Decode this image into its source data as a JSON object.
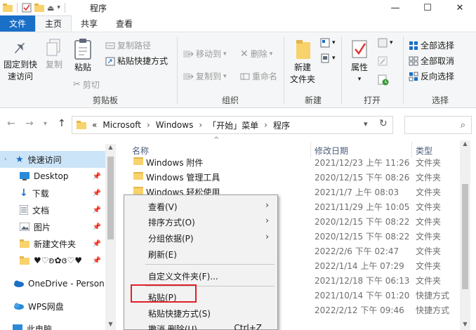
{
  "window": {
    "title": "程序"
  },
  "tabs": [
    "文件",
    "主页",
    "共享",
    "查看"
  ],
  "ribbon": {
    "pin_quick_access": [
      "固定到快",
      "速访问"
    ],
    "copy": "复制",
    "paste": "粘贴",
    "copy_path": "复制路径",
    "paste_shortcut": "粘贴快捷方式",
    "cut": "剪切",
    "group_clipboard": "剪贴板",
    "move_to": "移动到",
    "copy_to": "复制到",
    "delete": "删除",
    "rename": "重命名",
    "group_organize": "组织",
    "new_folder": [
      "新建",
      "文件夹"
    ],
    "group_new": "新建",
    "properties": "属性",
    "group_open": "打开",
    "select_all": "全部选择",
    "select_none": "全部取消",
    "invert_selection": "反向选择",
    "group_select": "选择"
  },
  "address": {
    "prefix": "«",
    "crumbs": [
      "Microsoft",
      "Windows",
      "「开始」菜单",
      "程序"
    ]
  },
  "nav": {
    "quick_access": "快速访问",
    "items": [
      "Desktop",
      "下载",
      "文档",
      "图片",
      "新建文件夹",
      "♥♡ʚ✿ɞ♡♥"
    ],
    "onedrive": "OneDrive - Person",
    "wps": "WPS网盘",
    "this_pc": "此电脑"
  },
  "columns": {
    "name": "名称",
    "date": "修改日期",
    "type": "类型"
  },
  "files": [
    {
      "name": "Windows 附件",
      "date": "2021/12/23 上午 11:26",
      "type": "文件夹"
    },
    {
      "name": "Windows 管理工具",
      "date": "2020/12/15 下午 08:26",
      "type": "文件夹"
    },
    {
      "name": "Windows 轻松使用",
      "date": "2021/1/7 上午 08:03",
      "type": "文件夹"
    },
    {
      "name": "",
      "date": "2021/11/29 上午 10:05",
      "type": "文件夹"
    },
    {
      "name": "",
      "date": "2020/12/15 下午 08:22",
      "type": "文件夹"
    },
    {
      "name": "",
      "date": "2020/12/15 下午 08:22",
      "type": "文件夹"
    },
    {
      "name": "",
      "date": "2022/2/6 下午 02:47",
      "type": "文件夹"
    },
    {
      "name": "",
      "date": "2022/1/14 上午 07:29",
      "type": "文件夹"
    },
    {
      "name": "",
      "date": "2021/12/18 下午 06:13",
      "type": "文件夹"
    },
    {
      "name": "",
      "date": "2021/10/14 下午 01:20",
      "type": "快捷方式"
    },
    {
      "name": "",
      "date": "2022/2/12 下午 09:46",
      "type": "快捷方式"
    }
  ],
  "context_menu": {
    "view": "查看(V)",
    "sort": "排序方式(O)",
    "group": "分组依据(P)",
    "refresh": "刷新(E)",
    "customize": "自定义文件夹(F)...",
    "paste": "粘贴(P)",
    "paste_shortcut": "粘贴快捷方式(S)",
    "undo": "撤消 删除(U)",
    "undo_shortcut": "Ctrl+Z"
  },
  "colors": {
    "accent": "#1a6fc7",
    "highlight": "#e0202a",
    "folder": "#f8d26b"
  }
}
